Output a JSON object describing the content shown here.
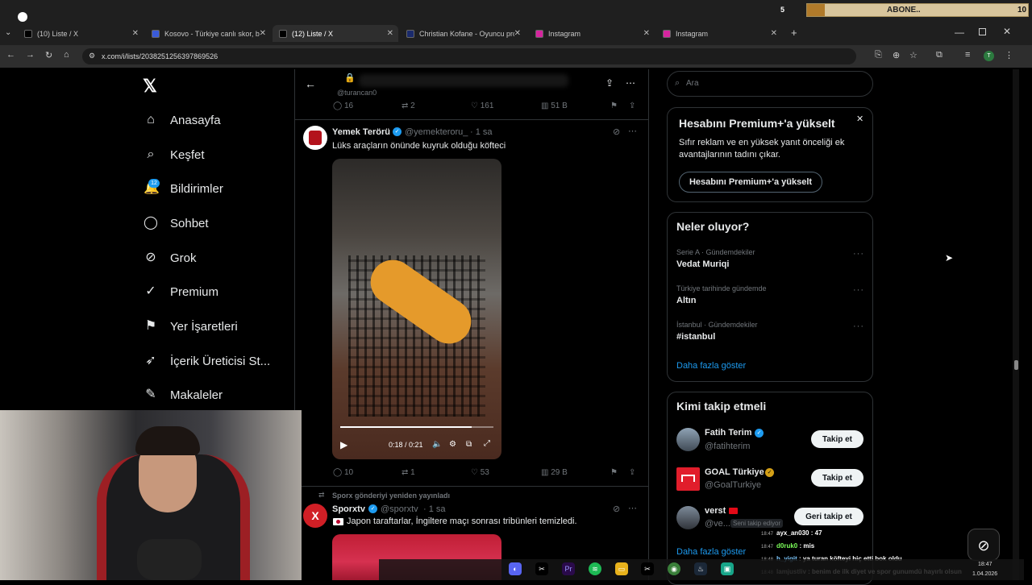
{
  "browser": {
    "tabs": [
      {
        "title": "(10) Liste / X",
        "color": "#000000"
      },
      {
        "title": "Kosovo - Türkiye canlı skor, baş",
        "color": "#3a5bd9"
      },
      {
        "title": "(12) Liste / X",
        "color": "#000000"
      },
      {
        "title": "Christian Kofane - Oyuncu profil",
        "color": "#1a2a6c"
      },
      {
        "title": "Instagram",
        "color": "#d6249f"
      },
      {
        "title": "Instagram",
        "color": "#d6249f"
      }
    ],
    "url": "x.com/i/lists/2038251256397869526",
    "add_tab": "+"
  },
  "overlay": {
    "subscribe_label": "ABONE..",
    "count_start": "5",
    "count_goal": "10"
  },
  "sidebar": {
    "items": [
      {
        "label": "Anasayfa",
        "icon": "home-icon",
        "glyph": "⌂"
      },
      {
        "label": "Keşfet",
        "icon": "search-icon",
        "glyph": "⌕"
      },
      {
        "label": "Bildirimler",
        "icon": "bell-icon",
        "glyph": "🔔"
      },
      {
        "label": "Sohbet",
        "icon": "chat-icon",
        "glyph": "◯"
      },
      {
        "label": "Grok",
        "icon": "grok-icon",
        "glyph": "⊘"
      },
      {
        "label": "Premium",
        "icon": "verified-icon",
        "glyph": "✓"
      },
      {
        "label": "Yer İşaretleri",
        "icon": "bookmark-icon",
        "glyph": "⚑"
      },
      {
        "label": "İçerik Üreticisi St...",
        "icon": "rocket-icon",
        "glyph": "➶"
      },
      {
        "label": "Makaleler",
        "icon": "article-icon",
        "glyph": "✎"
      }
    ],
    "notification_badge": "12"
  },
  "feed": {
    "header_handle": "@turancan0",
    "top_stats": {
      "replies": "16",
      "reposts": "2",
      "likes": "161",
      "views": "51 B"
    },
    "post1": {
      "name": "Yemek Terörü",
      "handle": "@yemekteroru_",
      "time": "· 1 sa",
      "text": "Lüks araçların önünde kuyruk olduğu köfteci",
      "video_time": "0:18 / 0:21",
      "video_progress": 0.86,
      "stats": {
        "replies": "10",
        "reposts": "1",
        "likes": "53",
        "views": "29 B"
      }
    },
    "repost_label": "Sporx gönderiyi yeniden yayınladı",
    "post2": {
      "name": "Sporxtv",
      "handle": "@sporxtv",
      "time": "· 1 sa",
      "text": "Japon taraftarlar, İngiltere maçı sonrası tribünleri temizledi."
    }
  },
  "right": {
    "search_placeholder": "Ara",
    "premium": {
      "title": "Hesabını Premium+'a yükselt",
      "body": "Sıfır reklam ve en yüksek yanıt önceliği ek avantajlarının tadını çıkar.",
      "button": "Hesabını Premium+'a yükselt"
    },
    "trends_title": "Neler oluyor?",
    "trends": [
      {
        "context": "Serie A · Gündemdekiler",
        "topic": "Vedat Muriqi"
      },
      {
        "context": "Türkiye tarihinde gündemde",
        "topic": "Altın"
      },
      {
        "context": "İstanbul · Gündemdekiler",
        "topic": "#istanbul"
      }
    ],
    "show_more": "Daha fazla göster",
    "follow_title": "Kimi takip etmeli",
    "follow": [
      {
        "name": "Fatih Terim",
        "handle": "@fatihterim",
        "button": "Takip et"
      },
      {
        "name": "GOAL Türkiye",
        "handle": "@GoalTurkiye",
        "button": "Takip et"
      },
      {
        "name": "verst",
        "handle": "@ve...",
        "tag": "Seni takip ediyor",
        "button": "Geri takip et"
      }
    ],
    "show_more2": "Daha fazla göster"
  },
  "stream_chat": [
    {
      "time": "18:47",
      "user": "ayx_an030",
      "msg": ": 47",
      "color": "#ffffff"
    },
    {
      "time": "18:47",
      "user": "d0ruk0",
      "msg": ": mis",
      "color": "#7cff5a"
    },
    {
      "time": "18:48",
      "user": "h_yigit",
      "msg": ": ya turan köfteyi hiç etti bok oldu",
      "color": "#7cc8ff"
    },
    {
      "time": "18:48",
      "user": "lamjustliv",
      "msg": ": benim de ilk diyet ve spor gunumdü hayırlı olsun",
      "color": "#bbbbbb"
    }
  ],
  "taskbar": {
    "time": "18:47",
    "date": "1.04.2026"
  }
}
